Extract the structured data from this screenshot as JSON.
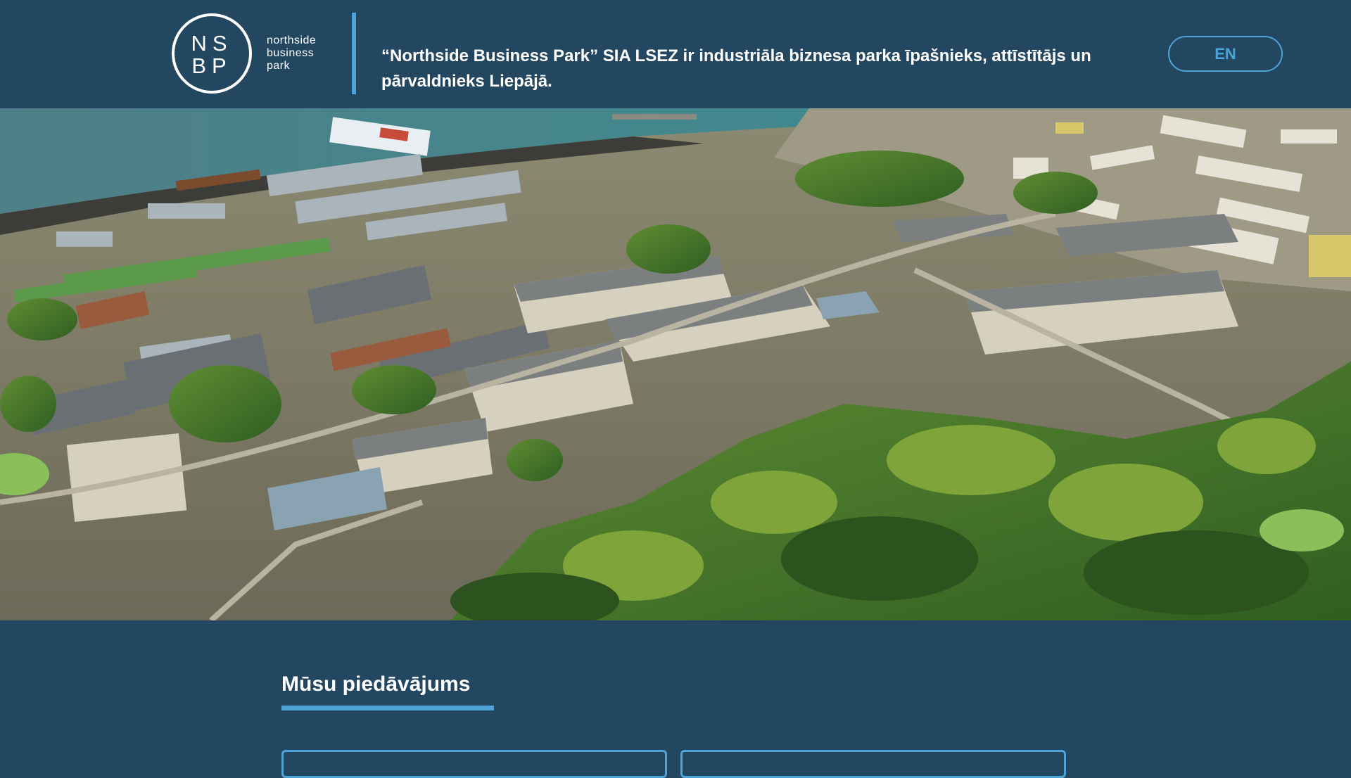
{
  "header": {
    "logo": {
      "monogram_top": "NS",
      "monogram_bottom": "BP",
      "name_line1": "northside",
      "name_line2": "business",
      "name_line3": "park"
    },
    "tagline": "“Northside Business Park” SIA LSEZ ir industriāla biznesa parka īpašnieks, attīstītājs un pārvaldnieks Liepājā.",
    "language_button": "EN"
  },
  "hero": {
    "image": "aerial-photo-industrial-business-park-liepaja"
  },
  "offers": {
    "title": "Mūsu piedāvājums"
  },
  "colors": {
    "background": "#234760",
    "accent": "#4ea3d8",
    "text": "#ffffff"
  }
}
